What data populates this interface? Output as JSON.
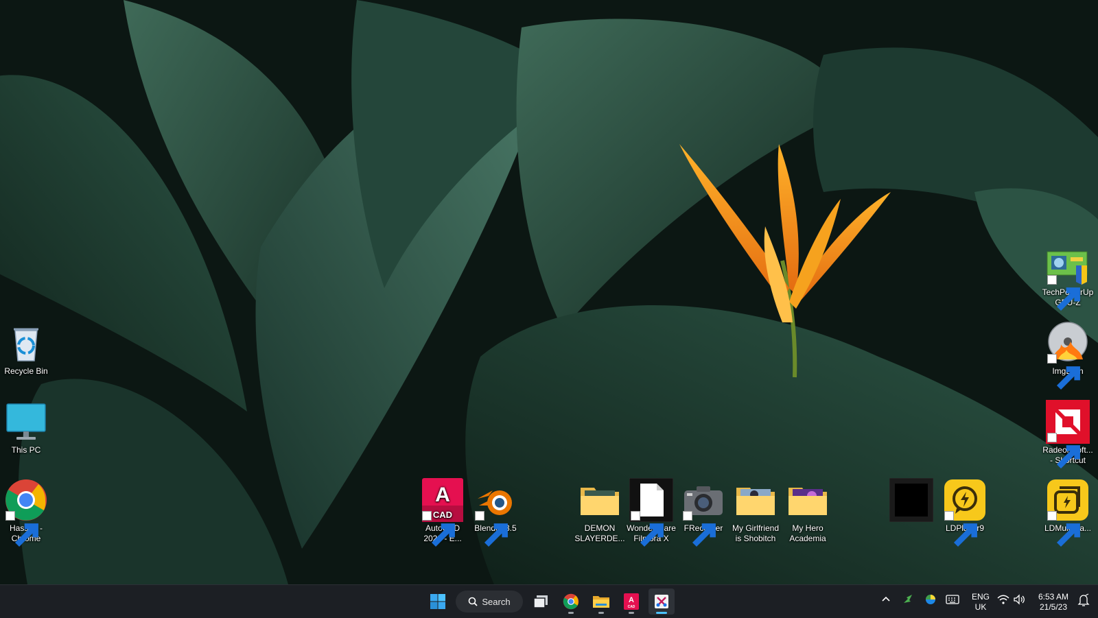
{
  "desktop": {
    "left_icons": [
      {
        "name": "Recycle Bin"
      },
      {
        "name": "This PC"
      },
      {
        "name": "Hassan -\nChrome"
      }
    ],
    "bottom_icons": [
      {
        "name": "AutoCAD\n2023 - E..."
      },
      {
        "name": "Blender 3.5"
      },
      {
        "name": "DEMON\nSLAYERDE..."
      },
      {
        "name": "Wondershare\nFilmora X"
      },
      {
        "name": "FRecorder"
      },
      {
        "name": "My Girlfriend\nis Shobitch"
      },
      {
        "name": "My Hero\nAcademia"
      },
      {
        "name": "LDPlayer9"
      }
    ],
    "right_icons": [
      {
        "name": "TechPowerUp\nGPU-Z"
      },
      {
        "name": "ImgBurn"
      },
      {
        "name": "RadeonSoft...\n- Shortcut"
      },
      {
        "name": "LDMultiPla..."
      }
    ]
  },
  "taskbar": {
    "search_label": "Search",
    "apps": [
      "start-icon",
      "task-view-icon",
      "chrome-icon",
      "file-explorer-icon",
      "autocad-icon",
      "snipping-tool-icon"
    ]
  },
  "tray": {
    "language": "ENG",
    "region": "UK",
    "time": "6:53 AM",
    "date": "21/5/23"
  },
  "colors": {
    "taskbar": "#1c1f24",
    "accent": "#4cc2ff",
    "wallpaper_leaf": "#1f3a30",
    "flower": "#f39c12"
  }
}
